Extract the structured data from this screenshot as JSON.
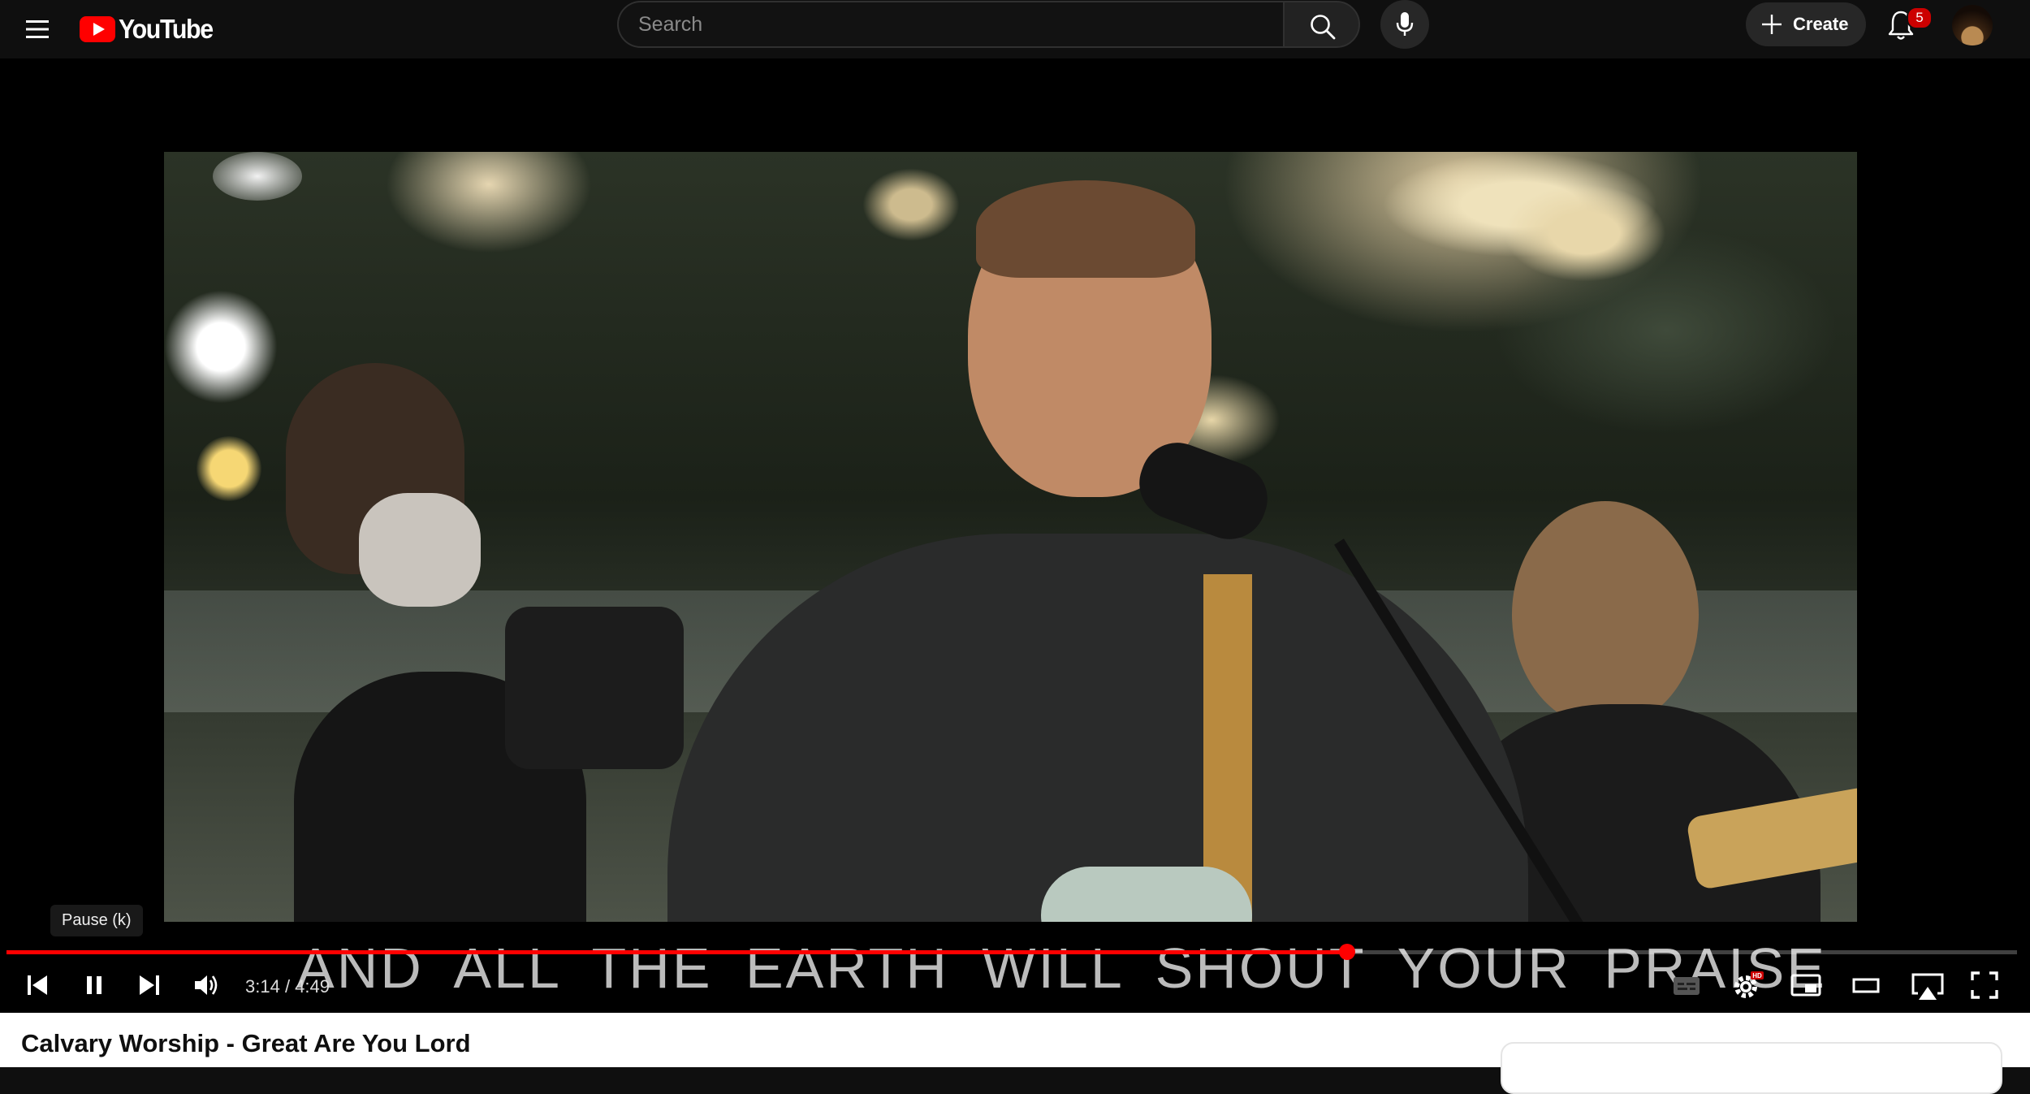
{
  "header": {
    "logo_text": "YouTube",
    "search_placeholder": "Search",
    "create_label": "Create",
    "notification_count": "5",
    "icons": [
      "menu-icon",
      "youtube-logo-icon",
      "search-icon",
      "microphone-icon",
      "plus-icon",
      "bell-icon"
    ]
  },
  "player": {
    "lyric_overlay": "AND ALL THE EARTH WILL SHOUT YOUR PRAISE",
    "tooltip": "Pause (k)",
    "current_time": "3:14",
    "time_separator": " / ",
    "duration": "4:49",
    "progress_fraction": 0.667,
    "accent_color": "#ff0000",
    "controls": [
      "previous-icon",
      "pause-icon",
      "next-icon",
      "volume-icon",
      "subtitles-icon",
      "settings-icon",
      "miniplayer-icon",
      "theater-mode-icon",
      "airplay-icon",
      "fullscreen-icon"
    ],
    "settings_badge": "HD"
  },
  "video": {
    "title": "Calvary Worship - Great Are You Lord"
  }
}
